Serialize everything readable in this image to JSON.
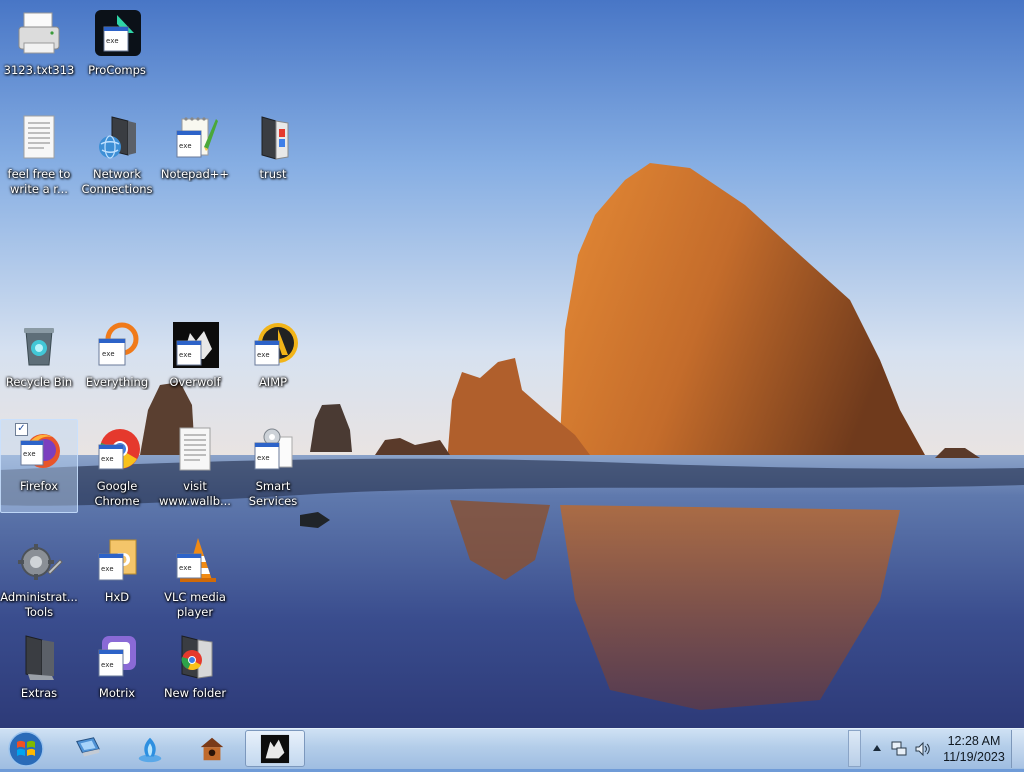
{
  "desktop": {
    "icons": [
      {
        "id": "file-3123",
        "label": "3123.txt313",
        "icon": "printer-file-icon",
        "selected": false
      },
      {
        "id": "procomps",
        "label": "ProComps",
        "icon": "app-window-icon",
        "selected": false
      },
      {
        "id": "feel-free",
        "label": "feel free to write a r...",
        "icon": "text-document-icon",
        "selected": false
      },
      {
        "id": "network-connections",
        "label": "Network Connections",
        "icon": "network-connections-icon",
        "selected": false
      },
      {
        "id": "notepadpp",
        "label": "Notepad++",
        "icon": "notepad-icon",
        "selected": false
      },
      {
        "id": "trust",
        "label": "trust",
        "icon": "folder-icon",
        "selected": false
      },
      {
        "id": "recycle-bin",
        "label": "Recycle Bin",
        "icon": "recycle-bin-icon",
        "selected": false
      },
      {
        "id": "everything",
        "label": "Everything",
        "icon": "search-app-icon",
        "selected": false
      },
      {
        "id": "overwolf",
        "label": "Overwolf",
        "icon": "wolf-icon",
        "selected": false
      },
      {
        "id": "aimp",
        "label": "AIMP",
        "icon": "aimp-icon",
        "selected": false
      },
      {
        "id": "firefox",
        "label": "Firefox",
        "icon": "firefox-icon",
        "selected": true
      },
      {
        "id": "google-chrome",
        "label": "Google Chrome",
        "icon": "chrome-icon",
        "selected": false
      },
      {
        "id": "visit-wallb",
        "label": "visit www.wallb...",
        "icon": "text-document-icon",
        "selected": false
      },
      {
        "id": "smart-services",
        "label": "Smart Services",
        "icon": "settings-file-icon",
        "selected": false
      },
      {
        "id": "admin-tools",
        "label": "Administrat... Tools",
        "icon": "admin-tools-icon",
        "selected": false
      },
      {
        "id": "hxd",
        "label": "HxD",
        "icon": "hex-editor-icon",
        "selected": false
      },
      {
        "id": "vlc",
        "label": "VLC media player",
        "icon": "vlc-icon",
        "selected": false
      },
      {
        "id": "extras",
        "label": "Extras",
        "icon": "dark-folder-icon",
        "selected": false
      },
      {
        "id": "motrix",
        "label": "Motrix",
        "icon": "motrix-icon",
        "selected": false
      },
      {
        "id": "new-folder",
        "label": "New folder",
        "icon": "chrome-folder-icon",
        "selected": false
      }
    ]
  },
  "taskbar": {
    "start_icon": "windows-logo-icon",
    "pinned": [
      {
        "id": "computer",
        "icon": "computer-icon",
        "active": false
      },
      {
        "id": "flame",
        "icon": "blue-flame-icon",
        "active": false
      },
      {
        "id": "birdhouse",
        "icon": "birdhouse-icon",
        "active": false
      },
      {
        "id": "overwolf-task",
        "icon": "wolf-icon",
        "active": true
      }
    ],
    "tray": {
      "expander_icon": "triangle-up-icon",
      "network_icon": "network-icon",
      "volume_icon": "speaker-icon",
      "clock_time": "12:28 AM",
      "clock_date": "11/19/2023"
    }
  },
  "colors": {
    "sky_top": "#4f7fc9",
    "sky_bottom": "#eae6e4",
    "rock": "#c9702a",
    "water": "#3a4f8c",
    "taskbar": "#b3cde9"
  }
}
